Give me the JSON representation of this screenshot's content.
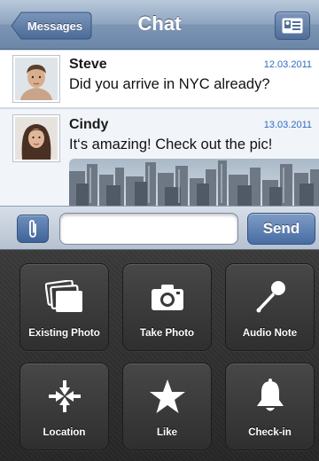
{
  "nav": {
    "back_label": "Messages",
    "title": "Chat",
    "contact_card_icon": "contact-card-icon"
  },
  "messages": [
    {
      "sender": "Steve",
      "date": "12.03.2011",
      "text": "Did you arrive in NYC already?",
      "avatar": "avatar-man"
    },
    {
      "sender": "Cindy",
      "date": "13.03.2011",
      "text": "It‘s amazing! Check out the pic!",
      "avatar": "avatar-woman",
      "attachment": "city-skyline-photo"
    }
  ],
  "compose": {
    "attach_icon": "paperclip-icon",
    "input_value": "",
    "input_placeholder": "",
    "send_label": "Send"
  },
  "actions": [
    {
      "label": "Existing Photo",
      "icon": "photos-icon"
    },
    {
      "label": "Take Photo",
      "icon": "camera-icon"
    },
    {
      "label": "Audio Note",
      "icon": "microphone-icon"
    },
    {
      "label": "Location",
      "icon": "location-arrows-icon"
    },
    {
      "label": "Like",
      "icon": "star-icon"
    },
    {
      "label": "Check-in",
      "icon": "bell-icon"
    }
  ],
  "colors": {
    "nav_bar": "#7d95b3",
    "date_text": "#2f6bc4",
    "send_button": "#476da3",
    "panel_bg": "#2f2f2f"
  }
}
